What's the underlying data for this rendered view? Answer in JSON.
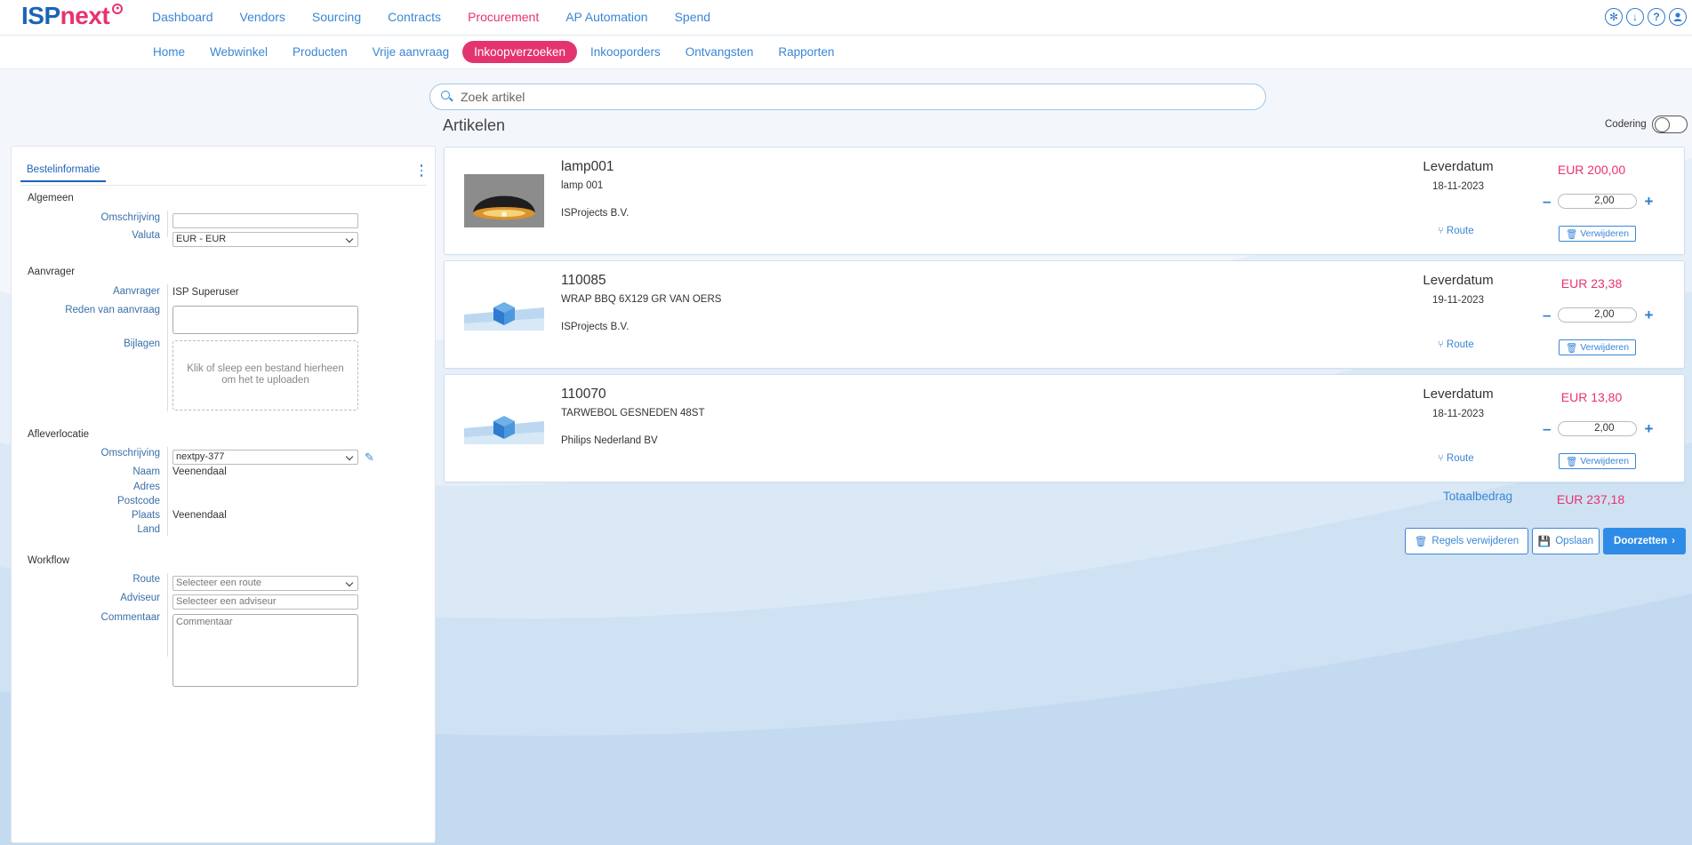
{
  "brand": {
    "isp": "ISP",
    "next": "next"
  },
  "main_nav": [
    {
      "label": "Dashboard",
      "active": false
    },
    {
      "label": "Vendors",
      "active": false
    },
    {
      "label": "Sourcing",
      "active": false
    },
    {
      "label": "Contracts",
      "active": false
    },
    {
      "label": "Procurement",
      "active": true
    },
    {
      "label": "AP Automation",
      "active": false
    },
    {
      "label": "Spend",
      "active": false
    }
  ],
  "top_icons": [
    "settings-icon",
    "download-icon",
    "help-icon",
    "user-icon"
  ],
  "sub_nav": [
    {
      "label": "Home",
      "active": false
    },
    {
      "label": "Webwinkel",
      "active": false
    },
    {
      "label": "Producten",
      "active": false
    },
    {
      "label": "Vrije aanvraag",
      "active": false
    },
    {
      "label": "Inkoopverzoeken",
      "active": true
    },
    {
      "label": "Inkooporders",
      "active": false
    },
    {
      "label": "Ontvangsten",
      "active": false
    },
    {
      "label": "Rapporten",
      "active": false
    }
  ],
  "search": {
    "placeholder": "Zoek artikel"
  },
  "articles_title": "Artikelen",
  "codering_label": "Codering",
  "left_panel": {
    "tab": "Bestelinformatie",
    "algemeen": {
      "title": "Algemeen",
      "omschrijving_label": "Omschrijving",
      "omschrijving_value": "",
      "valuta_label": "Valuta",
      "valuta_value": "EUR - EUR"
    },
    "aanvrager": {
      "title": "Aanvrager",
      "aanvrager_label": "Aanvrager",
      "aanvrager_value": "ISP Superuser",
      "reden_label": "Reden van aanvraag",
      "bijlagen_label": "Bijlagen",
      "dropzone_line1": "Klik of sleep een bestand hierheen",
      "dropzone_line2": "om het te uploaden"
    },
    "afleverlocatie": {
      "title": "Afleverlocatie",
      "omschrijving_label": "Omschrijving",
      "omschrijving_value": "nextpy-377",
      "naam_label": "Naam",
      "naam_value": "Veenendaal",
      "adres_label": "Adres",
      "postcode_label": "Postcode",
      "plaats_label": "Plaats",
      "plaats_value": "Veenendaal",
      "land_label": "Land"
    },
    "workflow": {
      "title": "Workflow",
      "route_label": "Route",
      "route_placeholder": "Selecteer een route",
      "adviseur_label": "Adviseur",
      "adviseur_placeholder": "Selecteer een adviseur",
      "commentaar_label": "Commentaar",
      "commentaar_placeholder": "Commentaar"
    }
  },
  "articles": [
    {
      "code": "lamp001",
      "description": "lamp 001",
      "supplier": "ISProjects B.V.",
      "leverdatum_label": "Leverdatum",
      "leverdatum": "18-11-2023",
      "route_label": "Route",
      "price": "EUR 200,00",
      "qty": "2,00",
      "delete_label": "Verwijderen",
      "image": "lamp"
    },
    {
      "code": "110085",
      "description": "WRAP BBQ 6X129 GR VAN OERS",
      "supplier": "ISProjects B.V.",
      "leverdatum_label": "Leverdatum",
      "leverdatum": "19-11-2023",
      "route_label": "Route",
      "price": "EUR 23,38",
      "qty": "2,00",
      "delete_label": "Verwijderen",
      "image": "box"
    },
    {
      "code": "110070",
      "description": "TARWEBOL GESNEDEN 48ST",
      "supplier": "Philips Nederland BV",
      "leverdatum_label": "Leverdatum",
      "leverdatum": "18-11-2023",
      "route_label": "Route",
      "price": "EUR 13,80",
      "qty": "2,00",
      "delete_label": "Verwijderen",
      "image": "box"
    }
  ],
  "total": {
    "label": "Totaalbedrag",
    "value": "EUR 237,18"
  },
  "actions": {
    "regels_verwijderen": "Regels verwijderen",
    "opslaan": "Opslaan",
    "doorzetten": "Doorzetten"
  },
  "colors": {
    "accent": "#e8336f",
    "primary": "#2f8ce6",
    "link": "#3a86d6"
  }
}
